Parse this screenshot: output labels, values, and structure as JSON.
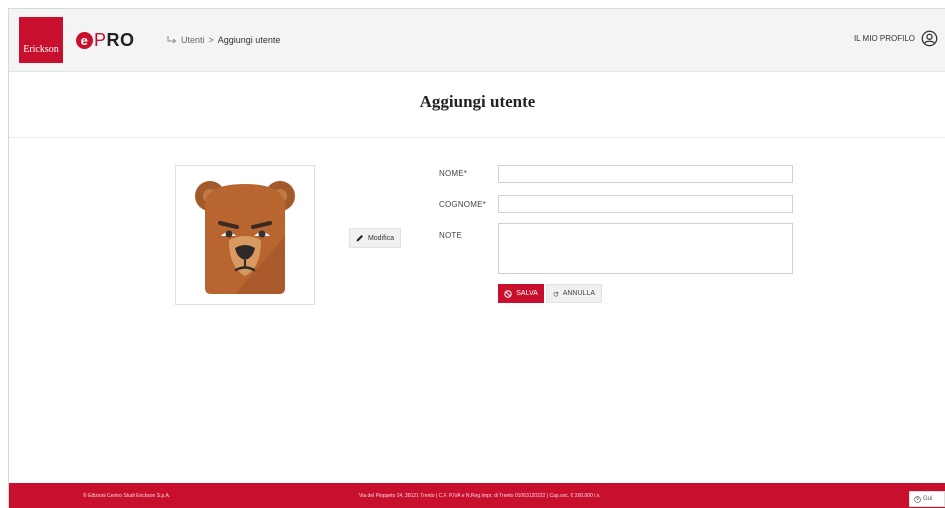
{
  "header": {
    "logo_text": "Erickson",
    "app_logo": {
      "e": "e",
      "p": "P",
      "ro": "RO"
    },
    "breadcrumb": {
      "parent": "Utenti",
      "separator": ">",
      "current": "Aggiungi utente"
    },
    "profile_label": "IL MIO PROFILO"
  },
  "page": {
    "title": "Aggiungi utente"
  },
  "avatar": {
    "modify_label": "Modifica"
  },
  "form": {
    "nome_label": "NOME*",
    "nome_value": "",
    "cognome_label": "COGNOME*",
    "cognome_value": "",
    "note_label": "NOTE",
    "note_value": "",
    "save_label": "SALVA",
    "cancel_label": "ANNULLA"
  },
  "footer": {
    "left_text": "© Edizioni Centro Studi Erickson S.p.A.",
    "center_text": "Via del Pioppeto 24, 38121 Trento | C.F. P.IVA e N.Reg.Impr. di Trento 01063120222 | Cap.soc. € 200.000 i.v."
  },
  "help_label": "Gui",
  "colors": {
    "brand": "#c8102e",
    "header_bg": "#f4f4f4"
  },
  "icons": [
    "return-arrow-icon",
    "user-circle-icon",
    "pencil-icon",
    "cancel-circle-icon",
    "refresh-icon",
    "help-icon"
  ]
}
